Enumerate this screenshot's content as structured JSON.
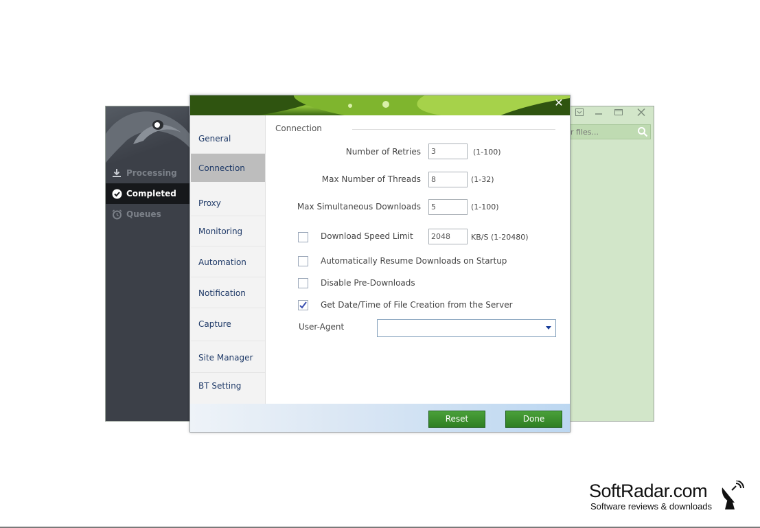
{
  "app": {
    "nav": [
      {
        "label": "Processing",
        "icon": "download-icon"
      },
      {
        "label": "Completed",
        "icon": "check-circle-icon"
      },
      {
        "label": "Queues",
        "icon": "alarm-clock-icon"
      }
    ],
    "search": {
      "placeholder": "r files..."
    },
    "colors": {
      "sidebar": "#3c4048",
      "main": "#d2e6c9",
      "active_nav": "#16181b"
    }
  },
  "dialog": {
    "nav": [
      {
        "label": "General"
      },
      {
        "label": "Connection"
      },
      {
        "label": "Proxy"
      },
      {
        "label": "Monitoring"
      },
      {
        "label": "Automation"
      },
      {
        "label": "Notification"
      },
      {
        "label": "Capture"
      },
      {
        "label": "Site Manager"
      },
      {
        "label": "BT Setting"
      }
    ],
    "active_nav": "Connection",
    "section_title": "Connection",
    "fields": {
      "retries": {
        "label": "Number of Retries",
        "value": "3",
        "hint": "(1-100)"
      },
      "threads": {
        "label": "Max Number of Threads",
        "value": "8",
        "hint": "(1-32)"
      },
      "simultaneous": {
        "label": "Max Simultaneous Downloads",
        "value": "5",
        "hint": "(1-100)"
      },
      "speed_limit": {
        "label": "Download Speed Limit",
        "value": "2048",
        "hint": "KB/S (1-20480)",
        "checked": false
      }
    },
    "options": [
      {
        "label": "Automatically Resume Downloads on Startup",
        "checked": false
      },
      {
        "label": "Disable Pre-Downloads",
        "checked": false
      },
      {
        "label": "Get Date/Time of File Creation from the Server",
        "checked": true
      }
    ],
    "user_agent": {
      "label": "User-Agent",
      "value": ""
    },
    "buttons": {
      "reset": "Reset",
      "done": "Done"
    },
    "close_glyph": "✕"
  },
  "watermark": {
    "title": "SoftRadar.com",
    "subtitle": "Software reviews & downloads"
  }
}
